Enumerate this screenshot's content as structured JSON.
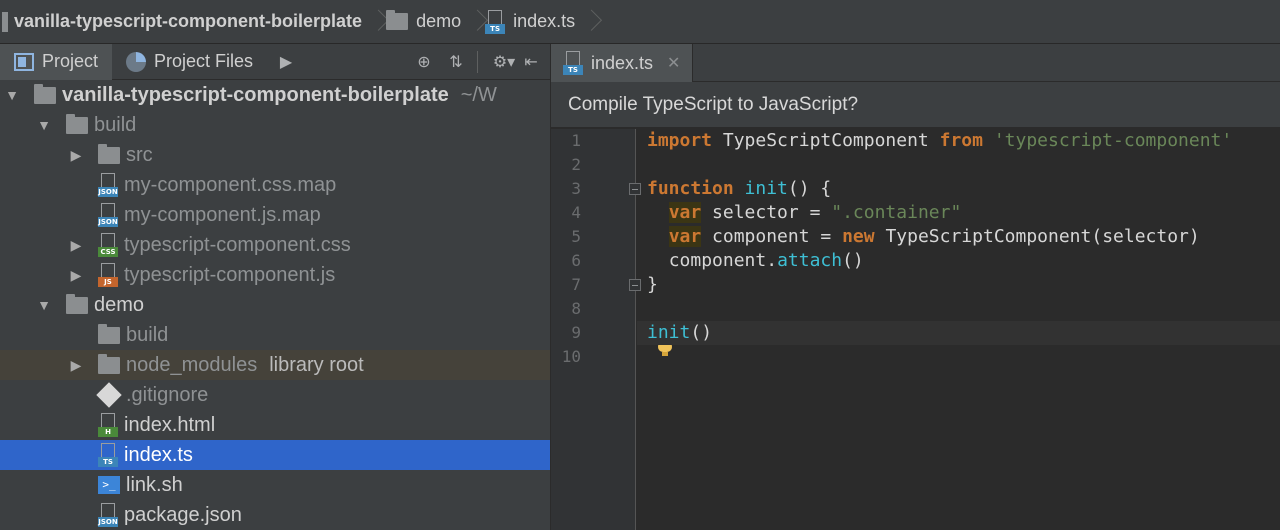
{
  "breadcrumb": {
    "items": [
      "vanilla-typescript-component-boilerplate",
      "demo",
      "index.ts"
    ]
  },
  "project_panel": {
    "tabs": [
      {
        "label": "Project"
      },
      {
        "label": "Project Files"
      }
    ],
    "tree": [
      {
        "name": "vanilla-typescript-component-boilerplate",
        "extra": "~/W",
        "type": "folder",
        "depth": 0,
        "expanded": true
      },
      {
        "name": "build",
        "type": "folder",
        "depth": 1,
        "expanded": true,
        "dim": true
      },
      {
        "name": "src",
        "type": "folder",
        "depth": 2,
        "expanded": false,
        "dim": true
      },
      {
        "name": "my-component.css.map",
        "type": "file",
        "badge": "JSON",
        "depth": 2,
        "dim": true
      },
      {
        "name": "my-component.js.map",
        "type": "file",
        "badge": "JSON",
        "depth": 2,
        "dim": true
      },
      {
        "name": "typescript-component.css",
        "type": "file",
        "badge": "CSS",
        "depth": 2,
        "expandable": true,
        "dim": true
      },
      {
        "name": "typescript-component.js",
        "type": "file",
        "badge": "JS",
        "depth": 2,
        "expandable": true,
        "dim": true
      },
      {
        "name": "demo",
        "type": "folder",
        "depth": 1,
        "expanded": true
      },
      {
        "name": "build",
        "type": "folder",
        "depth": 2,
        "dim": true
      },
      {
        "name": "node_modules",
        "extra": "library root",
        "type": "folder",
        "depth": 2,
        "expanded": false,
        "dim": true,
        "library": true
      },
      {
        "name": ".gitignore",
        "type": "git",
        "depth": 2,
        "dim": true
      },
      {
        "name": "index.html",
        "type": "file",
        "badge": "H",
        "depth": 2
      },
      {
        "name": "index.ts",
        "type": "file",
        "badge": "TS",
        "depth": 2,
        "selected": true
      },
      {
        "name": "link.sh",
        "type": "shell",
        "depth": 2
      },
      {
        "name": "package.json",
        "type": "file",
        "badge": "JSON",
        "depth": 2
      }
    ]
  },
  "editor": {
    "tab_label": "index.ts",
    "banner": "Compile TypeScript to JavaScript?",
    "line_numbers": [
      "1",
      "2",
      "3",
      "4",
      "5",
      "6",
      "7",
      "8",
      "9",
      "10"
    ],
    "code": {
      "l1": {
        "kw1": "import",
        "t1": " TypeScriptComponent ",
        "kw2": "from",
        "t2": " ",
        "str": "'typescript-component'"
      },
      "l3": {
        "kw": "function",
        "sp": " ",
        "fn": "init",
        "rest": "() {"
      },
      "l4": {
        "indent": "  ",
        "kw": "var",
        "t1": " selector = ",
        "str": "\".container\""
      },
      "l5": {
        "indent": "  ",
        "kw": "var",
        "t1": " component = ",
        "kw2": "new",
        "t2": " TypeScriptComponent",
        "rest": "(selector)"
      },
      "l6": {
        "indent": "  ",
        "t1": "component.",
        "fn": "attach",
        "rest": "()"
      },
      "l7": {
        "t1": "}"
      },
      "l9": {
        "fn": "init",
        "rest": "()"
      }
    }
  }
}
